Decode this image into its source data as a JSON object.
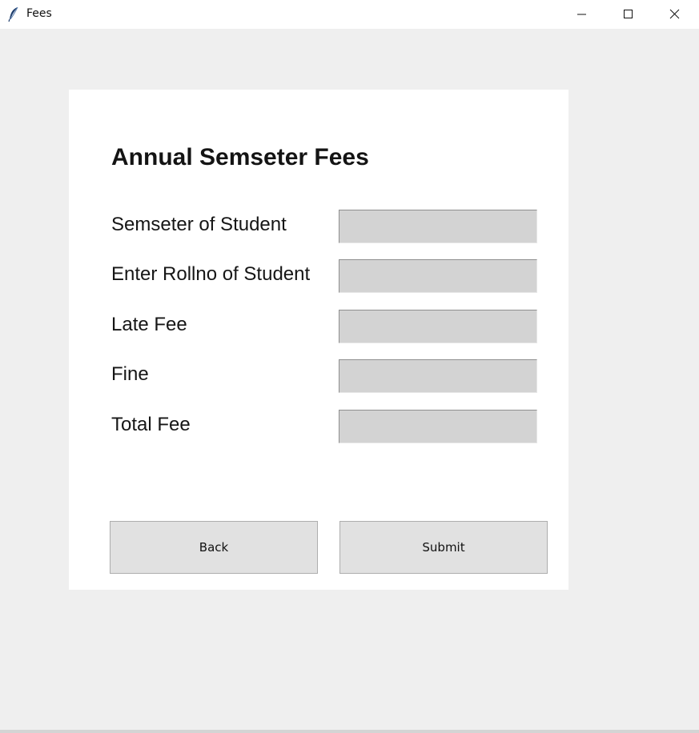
{
  "window": {
    "title": "Fees",
    "icon": "feather-icon",
    "controls": {
      "minimize": "minimize-icon",
      "maximize": "maximize-icon",
      "close": "close-icon"
    }
  },
  "form": {
    "heading": "Annual Semseter Fees",
    "fields": [
      {
        "label": "Semseter of Student",
        "value": ""
      },
      {
        "label": "Enter Rollno of Student",
        "value": ""
      },
      {
        "label": "Late Fee",
        "value": ""
      },
      {
        "label": "Fine",
        "value": ""
      },
      {
        "label": "Total Fee",
        "value": ""
      }
    ],
    "buttons": {
      "back": "Back",
      "submit": "Submit"
    }
  },
  "colors": {
    "field_background": "#d3d3d3",
    "button_background": "#e1e1e1",
    "client_background": "#efefef",
    "card_background": "#ffffff"
  }
}
